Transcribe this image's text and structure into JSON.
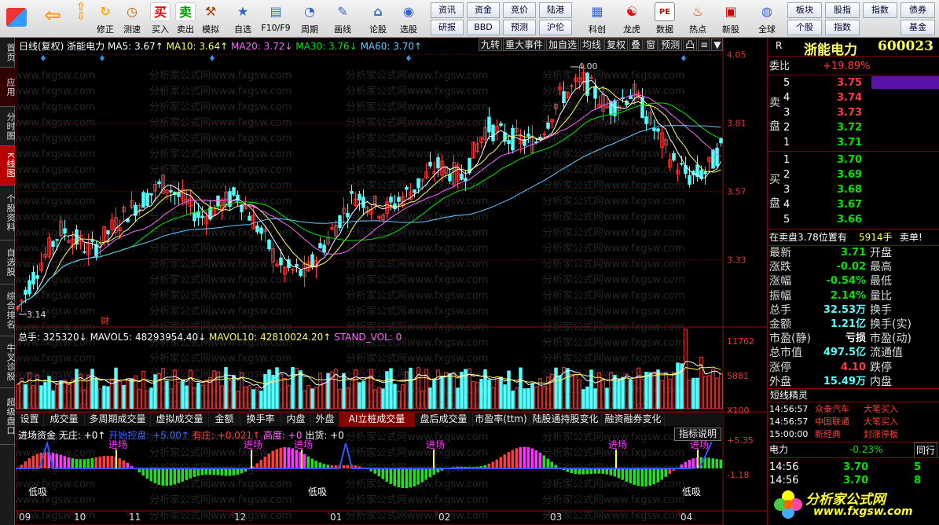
{
  "toolbar": {
    "buttons": [
      "修正",
      "测速",
      "买入",
      "卖出",
      "模拟",
      "自选",
      "F10/F9",
      "周期",
      "画线",
      "论股",
      "选股",
      "科创",
      "龙虎",
      "数据",
      "热点",
      "新股",
      "全球"
    ],
    "small": [
      [
        "资讯",
        "资金",
        "竞价",
        "陆港"
      ],
      [
        "研报",
        "BBD",
        "预测",
        "沪伦"
      ]
    ],
    "right": [
      [
        "板块",
        "股指",
        "指数",
        "债券"
      ],
      [
        "个股",
        "指数",
        "基金"
      ]
    ],
    "glyphs": {
      "buy": "买",
      "sell": "卖"
    }
  },
  "leftnav": [
    "首页",
    "应用",
    "分时图",
    "K线图",
    "个股资料",
    "自选股",
    "综合排名",
    "牛叉诊股",
    "超级盘口"
  ],
  "chart": {
    "header": {
      "name": "日线(复权)  浙能电力",
      "ma5": "MA5: 3.67↑",
      "ma10": "MA10: 3.64↑",
      "ma20": "MA20: 3.72↓",
      "ma30": "MA30: 3.76↓",
      "ma60": "MA60: 3.70↑"
    },
    "controls": [
      "九转",
      "重大事件",
      "加自选",
      "均线",
      "复权",
      "叠",
      "窗",
      "预测",
      "凸",
      "≡",
      "▼"
    ],
    "price_axis": [
      "4.05",
      "3.81",
      "3.57",
      "3.33"
    ],
    "hi_label": "4.00",
    "lo_label": "3.14",
    "cai": "财",
    "watermark": "分析家公式网www.fxgsw.com",
    "vol_header": {
      "total": "总手: 325320↓",
      "mavol5": "MAVOL5: 48293954.40↓",
      "mavol10": "MAVOL10: 42810024.20↑",
      "stand": "STAND_VOL: 0"
    },
    "vol_axis": [
      "11762",
      "5881",
      "X100"
    ],
    "tabs": [
      "设置",
      "成交量",
      "多周期成交量",
      "虚拟成交量",
      "金额",
      "换手率",
      "内盘",
      "外盘",
      "AI立桩成交量",
      "盘后成交量",
      "市盈率(ttm)",
      "陆股通持股变化",
      "融资融券变化"
    ],
    "ind_header": {
      "name": "进场资金",
      "wu": "无庄: +0↑",
      "kaishi": "开始控盘: +5.00↑",
      "youzhuang": "有庄: +0.021↑",
      "gaodu": "高度: +0",
      "chuhuo": "出货: +0"
    },
    "ind_button": "指标说明",
    "ind_axis": [
      "+5.35",
      "-1.18"
    ],
    "entry_label": "进场",
    "low_label": "低吸",
    "months": [
      "09",
      "10",
      "11",
      "12",
      "01",
      "02",
      "03",
      "04"
    ]
  },
  "right": {
    "name": "浙能电力",
    "code": "600023",
    "R": "R",
    "weibi_label": "委比",
    "weibi": "+19.89%",
    "sell_label": [
      "卖",
      "盘"
    ],
    "buy_label": [
      "买",
      "盘"
    ],
    "sell": [
      [
        "5",
        "3.75"
      ],
      [
        "4",
        "3.74"
      ],
      [
        "3",
        "3.73"
      ],
      [
        "2",
        "3.72"
      ],
      [
        "1",
        "3.71"
      ]
    ],
    "buy": [
      [
        "1",
        "3.70"
      ],
      [
        "2",
        "3.69"
      ],
      [
        "3",
        "3.68"
      ],
      [
        "4",
        "3.67"
      ],
      [
        "5",
        "3.66"
      ]
    ],
    "zaimai": "在卖盘3.78位置有",
    "zaimai_vol": "5914手",
    "zaimai_tag": "卖单!",
    "quote": [
      [
        "最新",
        "3.71",
        "开盘"
      ],
      [
        "涨跌",
        "-0.02",
        "最高"
      ],
      [
        "涨幅",
        "-0.54%",
        "最低"
      ],
      [
        "振幅",
        "2.14%",
        "量比"
      ],
      [
        "总手",
        "32.53万",
        "换手"
      ],
      [
        "金额",
        "1.21亿",
        "换手(实)"
      ],
      [
        "市盈(静)",
        "亏损",
        "市盈(动)"
      ],
      [
        "总市值",
        "497.5亿",
        "流通值"
      ],
      [
        "涨停",
        "4.10",
        "跌停"
      ],
      [
        "外盘",
        "15.49万",
        "内盘"
      ]
    ],
    "short_title": "短线精灵",
    "short": [
      [
        "14:56:57",
        "众泰汽车",
        "大笔买入"
      ],
      [
        "14:56:57",
        "中国联通",
        "大笔买入"
      ],
      [
        "15:00:00",
        "新经典",
        "封涨停板"
      ]
    ],
    "sector": [
      "电力",
      "-0.23%",
      "同行"
    ],
    "ticks": [
      [
        "14:56",
        "3.70",
        "5"
      ],
      [
        "14:56",
        "3.70",
        "8"
      ]
    ],
    "logo": "分析家公式网",
    "logo_url": "www.fxgsw.com"
  }
}
